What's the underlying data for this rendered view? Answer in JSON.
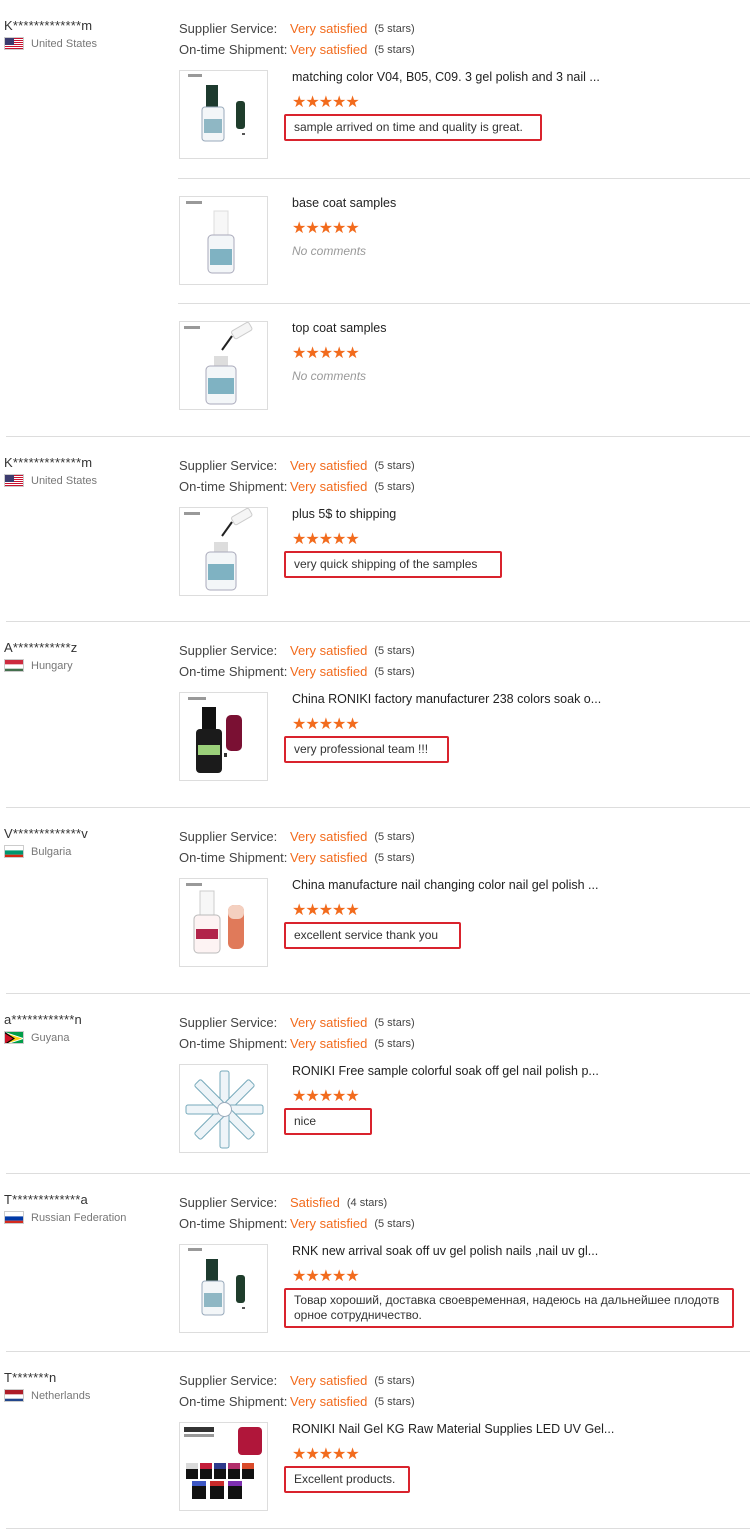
{
  "labels": {
    "supplier": "Supplier Service:",
    "shipment": "On-time Shipment:",
    "no_comments": "No comments"
  },
  "colors": {
    "accent": "#f26b1d",
    "highlight": "#d9232d"
  },
  "reviews": [
    {
      "user": "K*************m",
      "country": "United States",
      "flag": "us",
      "supplier": {
        "value": "Very satisfied",
        "stars": "(5 stars)"
      },
      "shipment": {
        "value": "Very satisfied",
        "stars": "(5 stars)"
      },
      "items": [
        {
          "title": "matching color V04, B05, C09. 3 gel polish and 3 nail ...",
          "rating": 5,
          "comment": "sample arrived on time and quality is great.",
          "thumb": "green"
        },
        {
          "title": "base coat samples",
          "rating": 5,
          "comment": "",
          "thumb": "bottle"
        },
        {
          "title": "top coat samples",
          "rating": 5,
          "comment": "",
          "thumb": "brush"
        }
      ]
    },
    {
      "user": "K*************m",
      "country": "United States",
      "flag": "us",
      "supplier": {
        "value": "Very satisfied",
        "stars": "(5 stars)"
      },
      "shipment": {
        "value": "Very satisfied",
        "stars": "(5 stars)"
      },
      "items": [
        {
          "title": "plus 5$ to shipping",
          "rating": 5,
          "comment": "very quick shipping of the samples",
          "thumb": "brush"
        }
      ]
    },
    {
      "user": "A***********z",
      "country": "Hungary",
      "flag": "hu",
      "supplier": {
        "value": "Very satisfied",
        "stars": "(5 stars)"
      },
      "shipment": {
        "value": "Very satisfied",
        "stars": "(5 stars)"
      },
      "items": [
        {
          "title": "China RONIKI factory manufacturer 238 colors soak o...",
          "rating": 5,
          "comment": "very professional team !!!",
          "thumb": "gelcolor"
        }
      ]
    },
    {
      "user": "V*************v",
      "country": "Bulgaria",
      "flag": "bg",
      "supplier": {
        "value": "Very satisfied",
        "stars": "(5 stars)"
      },
      "shipment": {
        "value": "Very satisfied",
        "stars": "(5 stars)"
      },
      "items": [
        {
          "title": "China manufacture nail changing color nail gel polish ...",
          "rating": 5,
          "comment": "excellent service  thank you",
          "thumb": "changing"
        }
      ]
    },
    {
      "user": "a************n",
      "country": "Guyana",
      "flag": "gy",
      "supplier": {
        "value": "Very satisfied",
        "stars": "(5 stars)"
      },
      "shipment": {
        "value": "Very satisfied",
        "stars": "(5 stars)"
      },
      "items": [
        {
          "title": "RONIKI Free sample colorful soak off gel nail polish p...",
          "rating": 5,
          "comment": "nice",
          "thumb": "fan"
        }
      ]
    },
    {
      "user": "T*************a",
      "country": "Russian Federation",
      "flag": "ru",
      "supplier": {
        "value": "Satisfied",
        "stars": "(4 stars)"
      },
      "shipment": {
        "value": "Very satisfied",
        "stars": "(5 stars)"
      },
      "items": [
        {
          "title": "RNK new arrival soak off uv gel polish nails ,nail uv gl...",
          "rating": 5,
          "comment": "Товар хороший, доставка своевременная, надеюсь на дальнейшее плодотв\nорное сотрудничество.",
          "thumb": "green"
        }
      ]
    },
    {
      "user": "T*******n",
      "country": "Netherlands",
      "flag": "nl",
      "supplier": {
        "value": "Very satisfied",
        "stars": "(5 stars)"
      },
      "shipment": {
        "value": "Very satisfied",
        "stars": "(5 stars)"
      },
      "items": [
        {
          "title": "RONIKI Nail Gel KG Raw Material Supplies LED UV Gel...",
          "rating": 5,
          "comment": "Excellent products.",
          "thumb": "jars"
        }
      ]
    }
  ]
}
